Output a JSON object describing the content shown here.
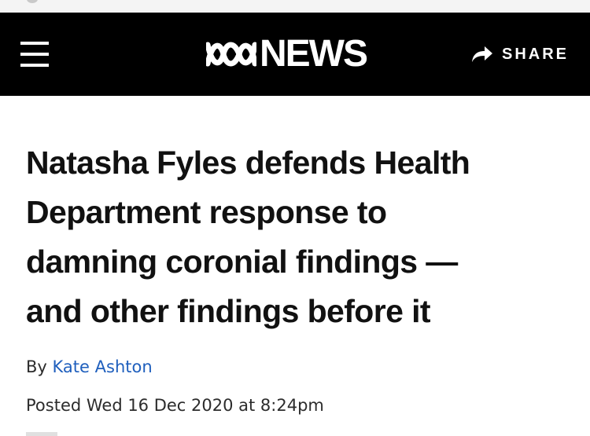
{
  "header": {
    "logo_text": "NEWS",
    "share_label": "SHARE",
    "menu_icon": "hamburger-menu-icon",
    "share_icon": "share-arrow-icon",
    "background_color": "#000000"
  },
  "article": {
    "headline_lines": [
      "Natasha Fyles defends Health",
      "Department response to",
      "damning coronial findings —",
      "and other findings before it"
    ],
    "byline_prefix": "By",
    "author": "Kate Ashton",
    "posted": "Posted Wed 16 Dec 2020 at 8:24pm"
  },
  "colors": {
    "author_link": "#1f5fbd"
  }
}
